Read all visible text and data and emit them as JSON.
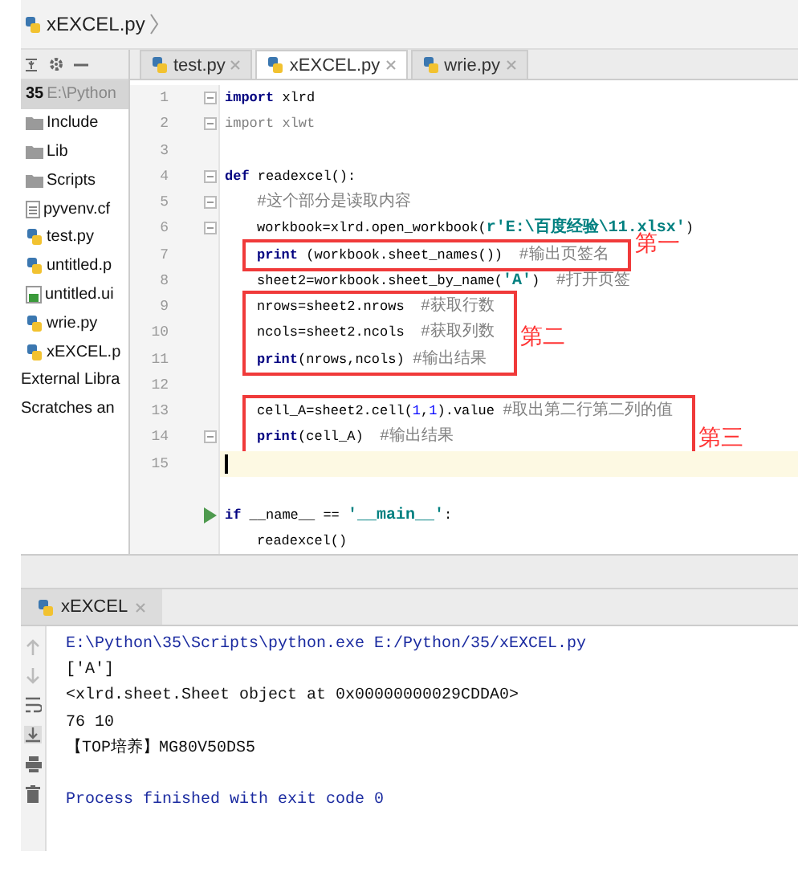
{
  "breadcrumb": {
    "file": "xEXCEL.py"
  },
  "project_panel": {
    "items": [
      {
        "label": "35",
        "path": "E:\\Python",
        "kind": "root",
        "selected": true
      },
      {
        "label": "Include",
        "kind": "folder",
        "selected": false
      },
      {
        "label": "Lib",
        "kind": "folder",
        "selected": false
      },
      {
        "label": "Scripts",
        "kind": "folder",
        "selected": false
      },
      {
        "label": "pyvenv.cf",
        "kind": "text",
        "selected": false
      },
      {
        "label": "test.py",
        "kind": "python",
        "selected": false
      },
      {
        "label": "untitled.p",
        "kind": "python",
        "selected": false
      },
      {
        "label": "untitled.ui",
        "kind": "ui",
        "selected": false
      },
      {
        "label": "wrie.py",
        "kind": "python",
        "selected": false
      },
      {
        "label": "xEXCEL.p",
        "kind": "python",
        "selected": false
      },
      {
        "label": "External Libra",
        "kind": "section",
        "selected": false
      },
      {
        "label": "Scratches an",
        "kind": "section",
        "selected": false
      }
    ]
  },
  "editor_tabs": [
    {
      "label": "test.py",
      "selected": false
    },
    {
      "label": "xEXCEL.py",
      "selected": true
    },
    {
      "label": "wrie.py",
      "selected": false
    }
  ],
  "code": [
    {
      "kind": "plain",
      "lines": [
        {
          "number": "1",
          "fold": true,
          "run": false,
          "indent": false,
          "current": false,
          "tokens": [
            {
              "kind": "keyword",
              "text": "import"
            },
            {
              "kind": "plain",
              "text": " xlrd"
            }
          ]
        },
        {
          "number": "2",
          "fold": true,
          "run": false,
          "indent": false,
          "current": false,
          "tokens": [
            {
              "kind": "unused",
              "text": "import xlwt"
            }
          ]
        },
        {
          "number": "3",
          "fold": false,
          "run": false,
          "current": false
        },
        {
          "number": "4",
          "fold": true,
          "run": false,
          "indent": false,
          "current": false,
          "tokens": [
            {
              "kind": "keyword",
              "text": "def"
            },
            {
              "kind": "plain",
              "text": " readexcel():"
            }
          ]
        },
        {
          "number": "5",
          "fold": true,
          "run": false,
          "indent": true,
          "current": false,
          "tokens": [
            {
              "kind": "comment",
              "text": "#这个部分是读取内容"
            }
          ]
        },
        {
          "number": "6",
          "fold": true,
          "run": false,
          "indent": true,
          "current": false,
          "tokens": [
            {
              "kind": "plain",
              "text": "workbook=xlrd.open_workbook("
            },
            {
              "kind": "string",
              "text": "r'E:\\百度经验\\11.xlsx'"
            },
            {
              "kind": "plain",
              "text": ")"
            }
          ]
        }
      ]
    },
    {
      "kind": "boxed",
      "label": "第一",
      "lines": [
        {
          "number": "7",
          "fold": false,
          "run": false,
          "indent": true,
          "current": false,
          "tokens": [
            {
              "kind": "keyword",
              "text": "print"
            },
            {
              "kind": "plain",
              "text": " (workbook.sheet_names())  "
            },
            {
              "kind": "comment",
              "text": "#输出页签名"
            }
          ]
        }
      ]
    },
    {
      "kind": "plain",
      "lines": [
        {
          "number": "8",
          "fold": false,
          "run": false,
          "indent": true,
          "current": false,
          "tokens": [
            {
              "kind": "plain",
              "text": "sheet2=workbook.sheet_by_name("
            },
            {
              "kind": "string",
              "text": "'A'"
            },
            {
              "kind": "plain",
              "text": ")  "
            },
            {
              "kind": "comment",
              "text": "#打开页签"
            }
          ]
        }
      ]
    },
    {
      "kind": "boxed",
      "label": "第二",
      "lines": [
        {
          "number": "9",
          "fold": false,
          "run": false,
          "indent": true,
          "current": false,
          "tokens": [
            {
              "kind": "plain",
              "text": "nrows=sheet2.nrows  "
            },
            {
              "kind": "comment",
              "text": "#获取行数"
            }
          ]
        },
        {
          "number": "10",
          "fold": false,
          "run": false,
          "indent": true,
          "current": false,
          "tokens": [
            {
              "kind": "plain",
              "text": "ncols=sheet2.ncols  "
            },
            {
              "kind": "comment",
              "text": "#获取列数"
            }
          ]
        },
        {
          "number": "11",
          "fold": false,
          "run": false,
          "indent": true,
          "current": false,
          "tokens": [
            {
              "kind": "keyword",
              "text": "print"
            },
            {
              "kind": "plain",
              "text": "(nrows,ncols) "
            },
            {
              "kind": "comment",
              "text": "#输出结果"
            }
          ]
        }
      ]
    },
    {
      "kind": "plain",
      "lines": [
        {
          "number": "12",
          "fold": false,
          "run": false,
          "current": false
        }
      ]
    },
    {
      "kind": "boxed",
      "label": "第三",
      "lines": [
        {
          "number": "13",
          "fold": false,
          "run": false,
          "indent": true,
          "current": false,
          "tokens": [
            {
              "kind": "plain",
              "text": "cell_A=sheet2.cell("
            },
            {
              "kind": "number",
              "text": "1"
            },
            {
              "kind": "plain",
              "text": ","
            },
            {
              "kind": "number",
              "text": "1"
            },
            {
              "kind": "plain",
              "text": ").value "
            },
            {
              "kind": "comment",
              "text": "#取出第二行第二列的值"
            }
          ]
        },
        {
          "number": "14",
          "fold": true,
          "run": false,
          "indent": true,
          "current": false,
          "tokens": [
            {
              "kind": "keyword",
              "text": "print"
            },
            {
              "kind": "plain",
              "text": "(cell_A)  "
            },
            {
              "kind": "comment",
              "text": "#输出结果"
            }
          ]
        }
      ]
    },
    {
      "kind": "plain",
      "lines": [
        {
          "number": "15",
          "fold": false,
          "run": false,
          "current": true
        },
        {
          "fold": false,
          "run": false,
          "current": false
        },
        {
          "fold": false,
          "run": true,
          "indent": false,
          "current": false,
          "tokens": [
            {
              "kind": "keyword",
              "text": "if"
            },
            {
              "kind": "plain",
              "text": " __name__ == "
            },
            {
              "kind": "string",
              "text": "'__main__'"
            },
            {
              "kind": "plain",
              "text": ":"
            }
          ]
        },
        {
          "fold": false,
          "run": false,
          "indent": true,
          "current": false,
          "tokens": [
            {
              "kind": "plain",
              "text": "readexcel()"
            }
          ]
        }
      ]
    }
  ],
  "run_panel": {
    "tab": "xEXCEL",
    "console": [
      {
        "kind": "command",
        "text": "E:\\Python\\35\\Scripts\\python.exe E:/Python/35/xEXCEL.py"
      },
      {
        "kind": "output",
        "text": "['A']"
      },
      {
        "kind": "output",
        "text": "<xlrd.sheet.Sheet object at 0x00000000029CDDA0>"
      },
      {
        "kind": "output",
        "text": "76 10"
      },
      {
        "kind": "output",
        "text": "【TOP培养】MG80V50DS5"
      },
      {
        "kind": "blank"
      },
      {
        "kind": "exit",
        "text": "Process finished with exit code 0"
      }
    ]
  }
}
